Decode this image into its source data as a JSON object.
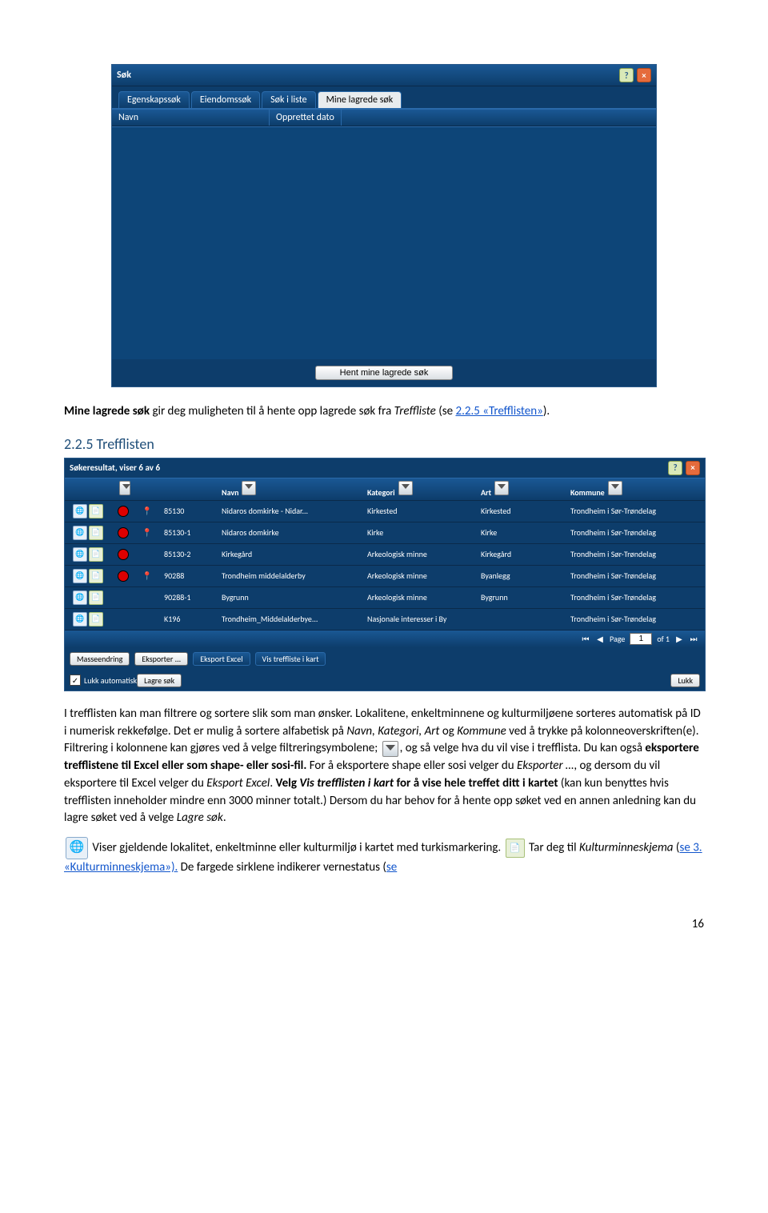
{
  "dialog1": {
    "title": "Søk",
    "tabs": [
      "Egenskapssøk",
      "Eiendomssøk",
      "Søk i liste",
      "Mine lagrede søk"
    ],
    "active_tab": 3,
    "columns": [
      "Navn",
      "Opprettet dato"
    ],
    "fetch_button": "Hent mine lagrede søk"
  },
  "para1": {
    "lead": "Mine lagrede søk",
    "mid": " gir deg muligheten til å hente opp lagrede søk fra ",
    "treffliste": "Treffliste",
    "se": " (se ",
    "link": "2.2.5 «Trefflisten»",
    "end": ")."
  },
  "section_heading": "2.2.5 Trefflisten",
  "result": {
    "title": "Søkeresultat, viser 6 av 6",
    "headers": {
      "navn": "Navn",
      "kategori": "Kategori",
      "art": "Art",
      "kommune": "Kommune"
    },
    "rows": [
      {
        "dot": "red",
        "pin": true,
        "id": "85130",
        "name": "Nidaros domkirke - Nidar...",
        "kat": "Kirkested",
        "art": "Kirkested",
        "kom": "Trondheim i Sør-Trøndelag"
      },
      {
        "dot": "red",
        "pin": true,
        "id": "85130-1",
        "name": "Nidaros domkirke",
        "kat": "Kirke",
        "art": "Kirke",
        "kom": "Trondheim i Sør-Trøndelag"
      },
      {
        "dot": "red",
        "pin": false,
        "id": "85130-2",
        "name": "Kirkegård",
        "kat": "Arkeologisk minne",
        "art": "Kirkegård",
        "kom": "Trondheim i Sør-Trøndelag"
      },
      {
        "dot": "red",
        "pin": true,
        "id": "90288",
        "name": "Trondheim middelalderby",
        "kat": "Arkeologisk minne",
        "art": "Byanlegg",
        "kom": "Trondheim i Sør-Trøndelag"
      },
      {
        "dot": "none",
        "pin": false,
        "id": "90288-1",
        "name": "Bygrunn",
        "kat": "Arkeologisk minne",
        "art": "Bygrunn",
        "kom": "Trondheim i Sør-Trøndelag"
      },
      {
        "dot": "none",
        "pin": false,
        "id": "K196",
        "name": "Trondheim_Middelalderbye...",
        "kat": "Nasjonale interesser i By",
        "art": "",
        "kom": "Trondheim i Sør-Trøndelag"
      }
    ],
    "pager": {
      "page_label": "Page",
      "page": "1",
      "of_label": "of 1"
    },
    "buttons": {
      "masseendring": "Masseendring",
      "eksporter": "Eksporter ...",
      "eksport_excel": "Eksport Excel",
      "vis_i_kart": "Vis treffliste i kart",
      "lagre_sok": "Lagre søk",
      "lukk": "Lukk"
    },
    "lukk_auto": "Lukk automatisk"
  },
  "para2": {
    "t1": "I trefflisten kan man filtrere og sortere slik som man ønsker. Lokalitene, enkeltminnene og kulturmiljøene sorteres automatisk på ID i numerisk rekkefølge. Det er mulig å sortere alfabetisk på ",
    "i1": "Navn, Kategori, Art",
    "t2": " og ",
    "i2": "Kommune",
    "t3": " ved å trykke på kolonneoverskriften(e). Filtrering i kolonnene kan gjøres ved å velge filtreringsymbolene; ",
    "t4": ", og så velge hva du vil vise i trefflista. Du kan også ",
    "b1": "eksportere trefflistene til Excel eller som shape- eller sosi-fil.",
    "t5": " For å eksportere shape eller sosi velger du ",
    "i3": "Eksporter …",
    "t6": ", og dersom du vil eksportere til Excel velger du ",
    "i4": "Eksport Excel",
    "t7": ". ",
    "b2a": "Velg ",
    "b2b": "Vis trefflisten i kart",
    "b2c": " for å vise hele treffet ditt i kartet",
    "t8": " (kan kun benyttes hvis trefflisten inneholder mindre enn 3000 minner totalt.) Dersom du har behov for å hente opp søket ved en annen anledning kan du lagre søket ved å velge ",
    "i5": "Lagre søk",
    "t9": "."
  },
  "para3": {
    "t1": " Viser gjeldende lokalitet, enkeltminne eller kulturmiljø i kartet med turkismarkering. ",
    "t2": " Tar deg til ",
    "i1": "Kulturminneskjema",
    "t3": " (",
    "link": "se 3. «Kulturminneskjema»).",
    "t4": " De fargede sirklene indikerer vernestatus (",
    "link2": "se"
  },
  "page_number": "16"
}
